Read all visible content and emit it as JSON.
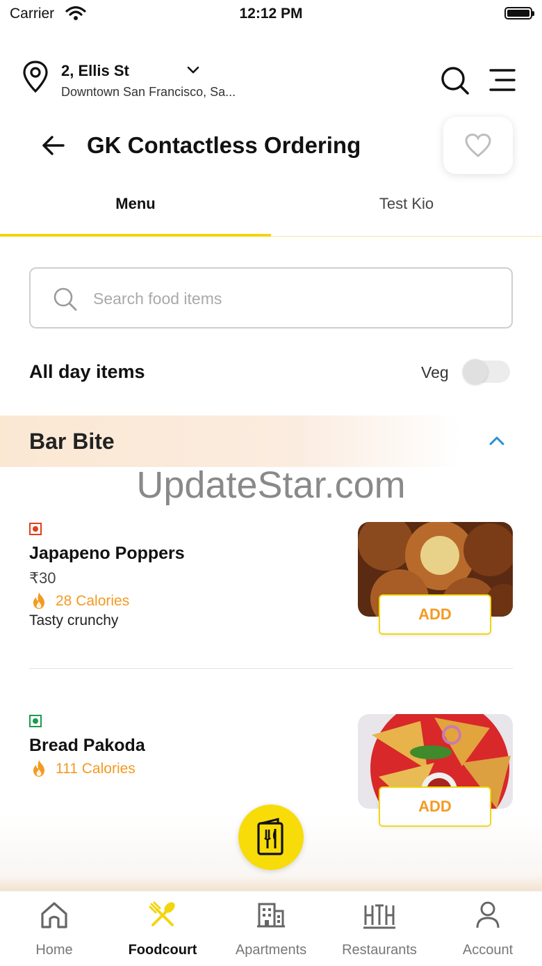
{
  "status_bar": {
    "carrier": "Carrier",
    "time": "12:12 PM"
  },
  "location": {
    "title": "2, Ellis St",
    "subtitle": "Downtown San Francisco, Sa..."
  },
  "page": {
    "title": "GK Contactless Ordering"
  },
  "tabs": [
    {
      "label": "Menu",
      "active": true
    },
    {
      "label": "Test Kio",
      "active": false
    }
  ],
  "search": {
    "placeholder": "Search food items",
    "value": ""
  },
  "filter": {
    "section_label": "All day items",
    "veg_label": "Veg",
    "veg_enabled": false
  },
  "category": {
    "title": "Bar Bite",
    "expanded": true
  },
  "watermark": "UpdateStar.com",
  "items": [
    {
      "name": "Japapeno Poppers",
      "price": "₹30",
      "calories": "28 Calories",
      "description": "Tasty crunchy",
      "diet": "non-veg",
      "add_label": "ADD"
    },
    {
      "name": "Bread Pakoda",
      "calories": "111 Calories",
      "diet": "veg",
      "add_label": "ADD"
    }
  ],
  "bottom_nav": [
    {
      "label": "Home",
      "icon": "home-icon",
      "active": false
    },
    {
      "label": "Foodcourt",
      "icon": "foodcourt-icon",
      "active": true
    },
    {
      "label": "Apartments",
      "icon": "apartments-icon",
      "active": false
    },
    {
      "label": "Restaurants",
      "icon": "restaurants-icon",
      "active": false
    },
    {
      "label": "Account",
      "icon": "account-icon",
      "active": false
    }
  ],
  "colors": {
    "accent": "#f2d50f",
    "calorie": "#f39a22",
    "non_veg": "#e0401c",
    "veg": "#1c9a4e",
    "expand_chevron": "#2b8fd6"
  }
}
